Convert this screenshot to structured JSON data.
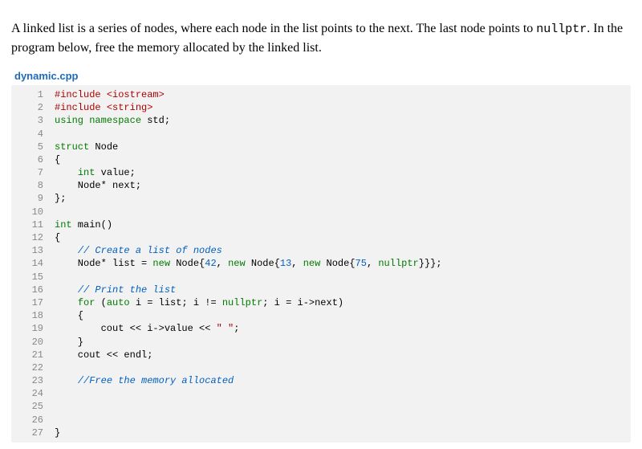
{
  "intro": {
    "part1": "A linked list is a series of nodes, where each node in the list points to the next. The last node points to ",
    "code": "nullptr",
    "part2": ". In the program below, free the memory allocated by the linked list."
  },
  "filename": "dynamic.cpp",
  "code": {
    "lines": [
      {
        "n": "1",
        "tokens": [
          {
            "c": "pre",
            "t": "#include "
          },
          {
            "c": "hdr",
            "t": "<iostream>"
          }
        ]
      },
      {
        "n": "2",
        "tokens": [
          {
            "c": "pre",
            "t": "#include "
          },
          {
            "c": "hdr",
            "t": "<string>"
          }
        ]
      },
      {
        "n": "3",
        "tokens": [
          {
            "c": "kw",
            "t": "using"
          },
          {
            "c": "id",
            "t": " "
          },
          {
            "c": "kw",
            "t": "namespace"
          },
          {
            "c": "id",
            "t": " std;"
          }
        ]
      },
      {
        "n": "4",
        "tokens": [
          {
            "c": "id",
            "t": ""
          }
        ]
      },
      {
        "n": "5",
        "tokens": [
          {
            "c": "kw",
            "t": "struct"
          },
          {
            "c": "id",
            "t": " Node"
          }
        ]
      },
      {
        "n": "6",
        "tokens": [
          {
            "c": "id",
            "t": "{"
          }
        ]
      },
      {
        "n": "7",
        "tokens": [
          {
            "c": "id",
            "t": "    "
          },
          {
            "c": "kw",
            "t": "int"
          },
          {
            "c": "id",
            "t": " value;"
          }
        ]
      },
      {
        "n": "8",
        "tokens": [
          {
            "c": "id",
            "t": "    Node* next;"
          }
        ]
      },
      {
        "n": "9",
        "tokens": [
          {
            "c": "id",
            "t": "};"
          }
        ]
      },
      {
        "n": "10",
        "tokens": [
          {
            "c": "id",
            "t": ""
          }
        ]
      },
      {
        "n": "11",
        "tokens": [
          {
            "c": "kw",
            "t": "int"
          },
          {
            "c": "id",
            "t": " main()"
          }
        ]
      },
      {
        "n": "12",
        "tokens": [
          {
            "c": "id",
            "t": "{"
          }
        ]
      },
      {
        "n": "13",
        "tokens": [
          {
            "c": "id",
            "t": "    "
          },
          {
            "c": "cm",
            "t": "// Create a list of nodes"
          }
        ]
      },
      {
        "n": "14",
        "tokens": [
          {
            "c": "id",
            "t": "    Node* list = "
          },
          {
            "c": "kw",
            "t": "new"
          },
          {
            "c": "id",
            "t": " Node{"
          },
          {
            "c": "num",
            "t": "42"
          },
          {
            "c": "id",
            "t": ", "
          },
          {
            "c": "kw",
            "t": "new"
          },
          {
            "c": "id",
            "t": " Node{"
          },
          {
            "c": "num",
            "t": "13"
          },
          {
            "c": "id",
            "t": ", "
          },
          {
            "c": "kw",
            "t": "new"
          },
          {
            "c": "id",
            "t": " Node{"
          },
          {
            "c": "num",
            "t": "75"
          },
          {
            "c": "id",
            "t": ", "
          },
          {
            "c": "kw",
            "t": "nullptr"
          },
          {
            "c": "id",
            "t": "}}};"
          }
        ]
      },
      {
        "n": "15",
        "tokens": [
          {
            "c": "id",
            "t": ""
          }
        ]
      },
      {
        "n": "16",
        "tokens": [
          {
            "c": "id",
            "t": "    "
          },
          {
            "c": "cm",
            "t": "// Print the list"
          }
        ]
      },
      {
        "n": "17",
        "tokens": [
          {
            "c": "id",
            "t": "    "
          },
          {
            "c": "kw",
            "t": "for"
          },
          {
            "c": "id",
            "t": " ("
          },
          {
            "c": "kw",
            "t": "auto"
          },
          {
            "c": "id",
            "t": " i = list; i != "
          },
          {
            "c": "kw",
            "t": "nullptr"
          },
          {
            "c": "id",
            "t": "; i = i->next)"
          }
        ]
      },
      {
        "n": "18",
        "tokens": [
          {
            "c": "id",
            "t": "    {"
          }
        ]
      },
      {
        "n": "19",
        "tokens": [
          {
            "c": "id",
            "t": "        cout << i->value << "
          },
          {
            "c": "str",
            "t": "\" \""
          },
          {
            "c": "id",
            "t": ";"
          }
        ]
      },
      {
        "n": "20",
        "tokens": [
          {
            "c": "id",
            "t": "    }"
          }
        ]
      },
      {
        "n": "21",
        "tokens": [
          {
            "c": "id",
            "t": "    cout << endl;"
          }
        ]
      },
      {
        "n": "22",
        "tokens": [
          {
            "c": "id",
            "t": ""
          }
        ]
      },
      {
        "n": "23",
        "tokens": [
          {
            "c": "id",
            "t": "    "
          },
          {
            "c": "cm",
            "t": "//Free the memory allocated"
          }
        ]
      },
      {
        "n": "24",
        "tokens": [
          {
            "c": "id",
            "t": ""
          }
        ]
      },
      {
        "n": "25",
        "tokens": [
          {
            "c": "id",
            "t": ""
          }
        ]
      },
      {
        "n": "26",
        "tokens": [
          {
            "c": "id",
            "t": ""
          }
        ]
      },
      {
        "n": "27",
        "tokens": [
          {
            "c": "id",
            "t": "}"
          }
        ]
      }
    ]
  }
}
